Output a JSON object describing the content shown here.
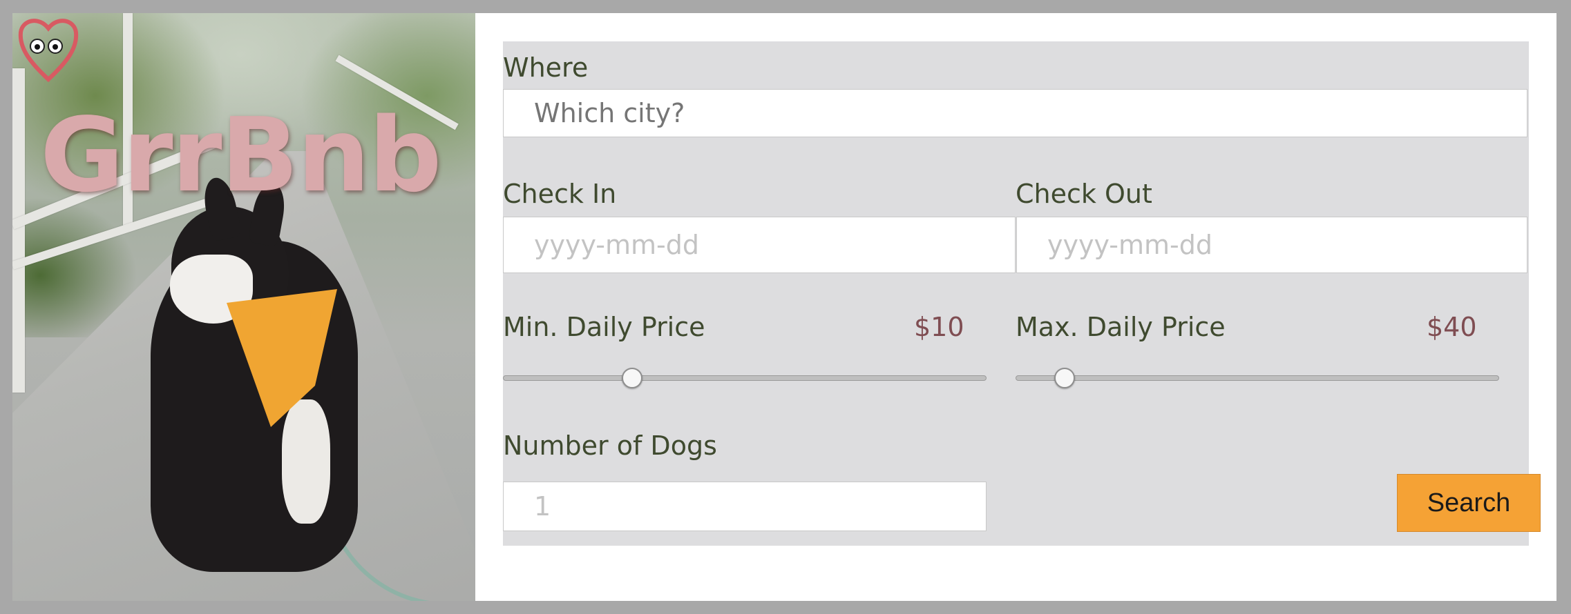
{
  "brand": {
    "name": "GrrBnb",
    "logo_icon": "heart-face-logo-icon",
    "hero_image": "dog-on-bridge-photo"
  },
  "form": {
    "where": {
      "label": "Where",
      "placeholder": "Which city?"
    },
    "check_in": {
      "label": "Check In",
      "placeholder": "yyyy-mm-dd"
    },
    "check_out": {
      "label": "Check Out",
      "placeholder": "yyyy-mm-dd"
    },
    "min_price": {
      "label": "Min. Daily Price",
      "value": "$10"
    },
    "max_price": {
      "label": "Max. Daily Price",
      "value": "$40"
    },
    "dogs": {
      "label": "Number of Dogs",
      "placeholder": "1"
    },
    "search_label": "Search"
  },
  "colors": {
    "accent": "#f5a235",
    "label_text": "#3f4a2f",
    "price_text": "#7f4d52",
    "form_bg": "#dddddf",
    "brand_pink": "#d9a9ab"
  }
}
